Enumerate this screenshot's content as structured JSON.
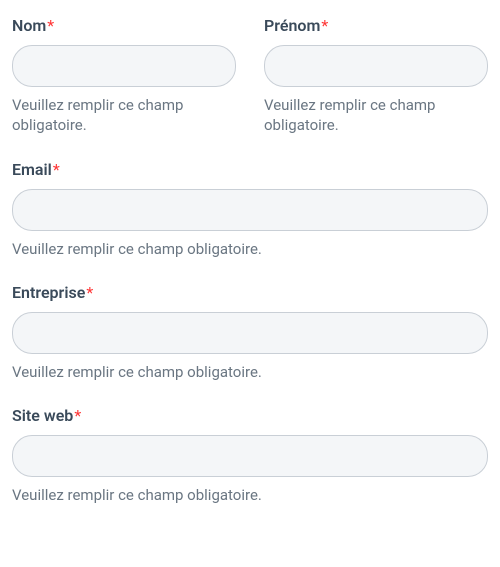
{
  "required_mark": "*",
  "fields": {
    "nom": {
      "label": "Nom",
      "value": "",
      "error": "Veuillez remplir ce champ obligatoire."
    },
    "prenom": {
      "label": "Prénom",
      "value": "",
      "error": "Veuillez remplir ce champ obligatoire."
    },
    "email": {
      "label": "Email",
      "value": "",
      "error": "Veuillez remplir ce champ obligatoire."
    },
    "entreprise": {
      "label": "Entreprise",
      "value": "",
      "error": "Veuillez remplir ce champ obligatoire."
    },
    "siteweb": {
      "label": "Site web",
      "value": "",
      "error": "Veuillez remplir ce champ obligatoire."
    }
  }
}
